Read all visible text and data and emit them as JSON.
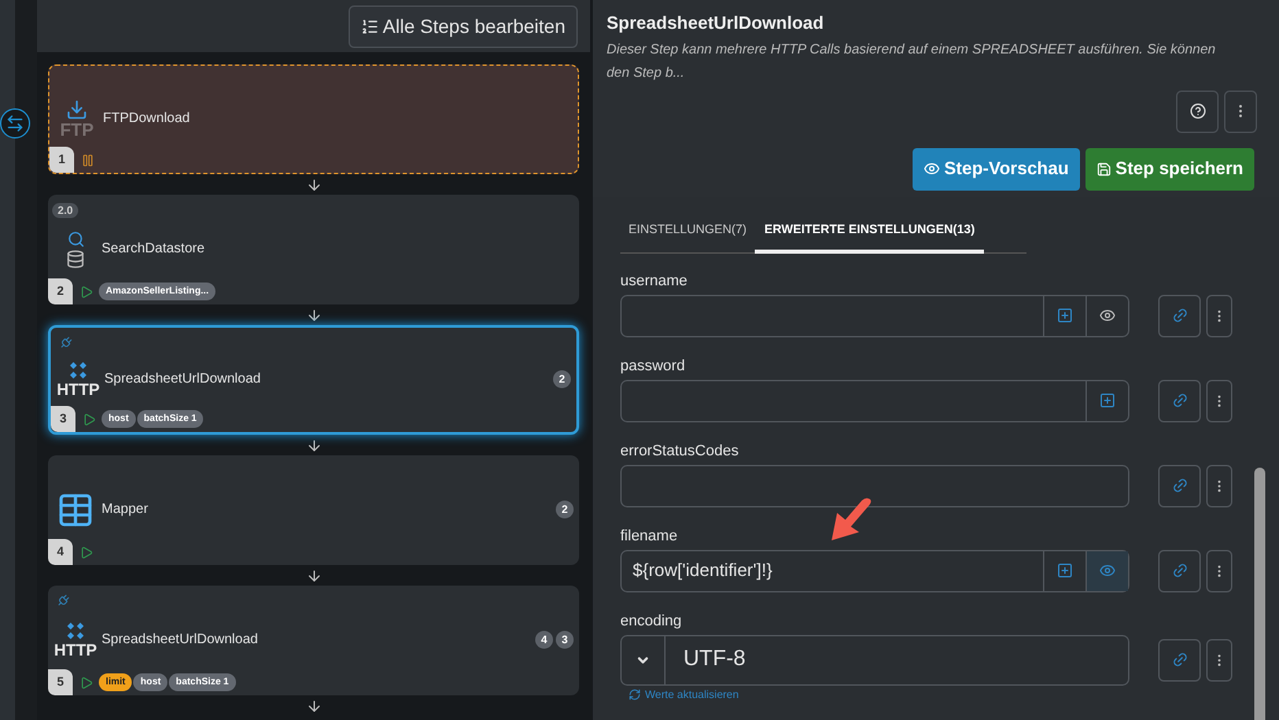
{
  "toolbar": {
    "edit_all_button": "Alle Steps bearbeiten"
  },
  "steps": [
    {
      "number": "1",
      "title": "FTPDownload",
      "kind": "ftp",
      "icon_label": "FTP",
      "paused": true,
      "selected": false,
      "plug": false
    },
    {
      "number": "2",
      "title": "SearchDatastore",
      "kind": "datastore",
      "version": "2.0",
      "paused": false,
      "selected": false,
      "plug": false,
      "chips": [
        {
          "label": "AmazonSellerListing...",
          "kind": "normal"
        }
      ]
    },
    {
      "number": "3",
      "title": "SpreadsheetUrlDownload",
      "kind": "http",
      "icon_label": "HTTP",
      "paused": false,
      "selected": true,
      "plug": true,
      "chips": [
        {
          "label": "host",
          "kind": "normal"
        },
        {
          "label": "batchSize 1",
          "kind": "normal"
        }
      ],
      "counts": [
        "2"
      ]
    },
    {
      "number": "4",
      "title": "Mapper",
      "kind": "table",
      "paused": false,
      "selected": false,
      "plug": false,
      "counts": [
        "2"
      ]
    },
    {
      "number": "5",
      "title": "SpreadsheetUrlDownload",
      "kind": "http",
      "icon_label": "HTTP",
      "paused": false,
      "selected": false,
      "plug": true,
      "chips": [
        {
          "label": "limit",
          "kind": "warning"
        },
        {
          "label": "host",
          "kind": "normal"
        },
        {
          "label": "batchSize 1",
          "kind": "normal"
        }
      ],
      "counts": [
        "4",
        "3"
      ]
    }
  ],
  "detail": {
    "title": "SpreadsheetUrlDownload",
    "description": "Dieser Step kann mehrere HTTP Calls basierend auf einem SPREADSHEET ausführen. Sie können den Step b...",
    "preview_button": "Step-Vorschau",
    "save_button": "Step speichern"
  },
  "tabs": [
    {
      "label": "EINSTELLUNGEN(7)",
      "selected": false
    },
    {
      "label": "ERWEITERTE EINSTELLUNGEN(13)",
      "selected": true
    }
  ],
  "fields": [
    {
      "label": "username",
      "kind": "text",
      "insert": true,
      "preview": true,
      "preview_active": false
    },
    {
      "label": "password",
      "kind": "text",
      "insert": true,
      "preview": false
    },
    {
      "label": "errorStatusCodes",
      "kind": "text",
      "insert": false,
      "preview": false
    },
    {
      "label": "filename",
      "kind": "text",
      "value": "${row['identifier']!}",
      "insert": true,
      "preview": true,
      "preview_active": true
    },
    {
      "label": "encoding",
      "kind": "select",
      "value": "UTF-8"
    }
  ],
  "refresh_link": "Werte aktualisieren"
}
